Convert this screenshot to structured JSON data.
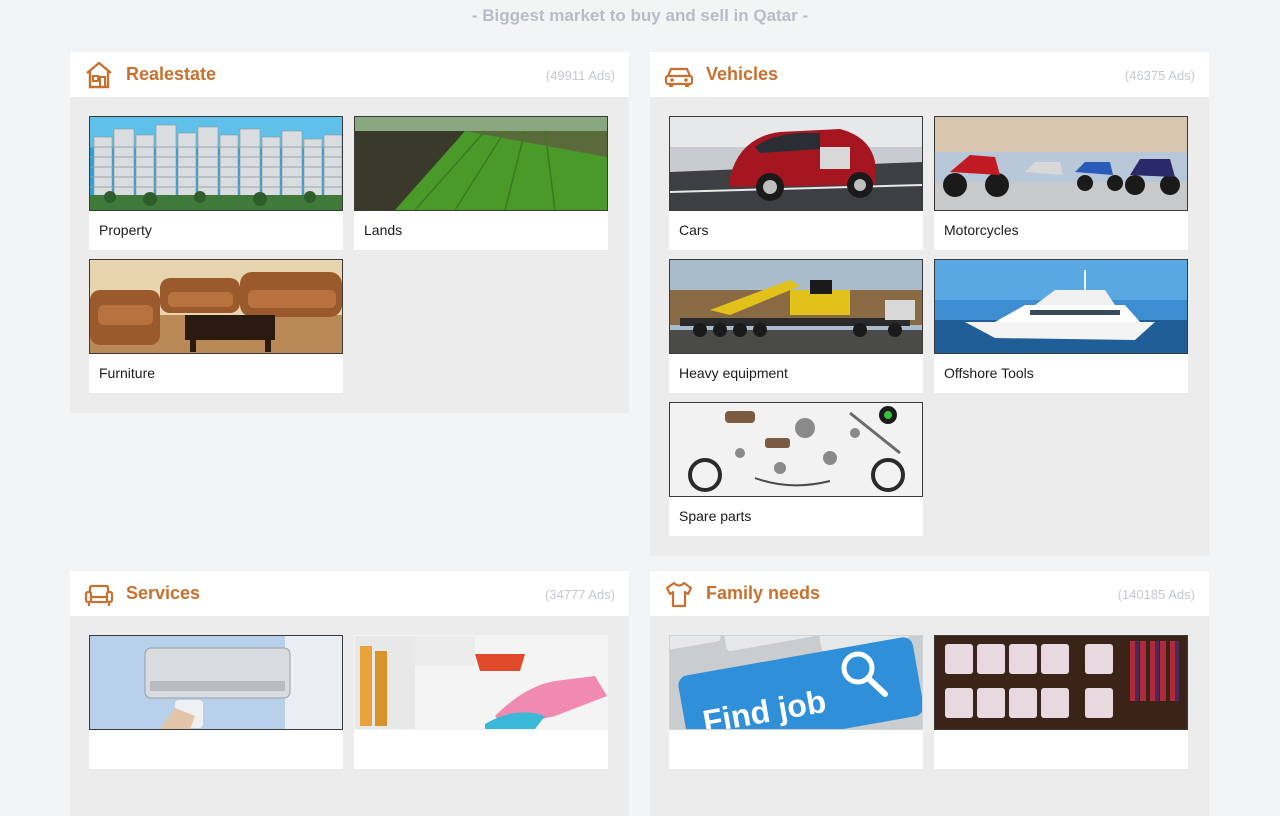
{
  "tagline": "- Biggest market to buy and sell in Qatar -",
  "colors": {
    "accent": "#c9702e",
    "page_bg": "#f3f4f6",
    "panel_bg": "#ececec",
    "count": "#c4c7cd"
  },
  "categories": [
    {
      "title": "Realestate",
      "count": "(49911 Ads)",
      "icon": "house-icon",
      "items": [
        {
          "label": "Property",
          "image": "apartment-buildings-image"
        },
        {
          "label": "Lands",
          "image": "green-field-image"
        },
        {
          "label": "Furniture",
          "image": "leather-sofa-set-image"
        }
      ]
    },
    {
      "title": "Vehicles",
      "count": "(46375 Ads)",
      "icon": "car-icon",
      "items": [
        {
          "label": "Cars",
          "image": "red-luxury-car-image"
        },
        {
          "label": "Motorcycles",
          "image": "motorcycles-row-image"
        },
        {
          "label": "Heavy equipment",
          "image": "excavator-on-trailer-image"
        },
        {
          "label": "Offshore Tools",
          "image": "yacht-image"
        },
        {
          "label": "Spare parts",
          "image": "motorcycle-parts-image"
        }
      ]
    },
    {
      "title": "Services",
      "count": "(34777 Ads)",
      "icon": "sofa-icon",
      "items": [
        {
          "label": "",
          "image": "air-conditioner-image"
        },
        {
          "label": "",
          "image": "cleaning-gloves-image"
        }
      ]
    },
    {
      "title": "Family needs",
      "count": "(140185 Ads)",
      "icon": "shirt-icon",
      "items": [
        {
          "label": "",
          "image": "find-job-key-image",
          "image_text": "Find job"
        },
        {
          "label": "",
          "image": "shirts-and-ties-image"
        }
      ]
    }
  ]
}
